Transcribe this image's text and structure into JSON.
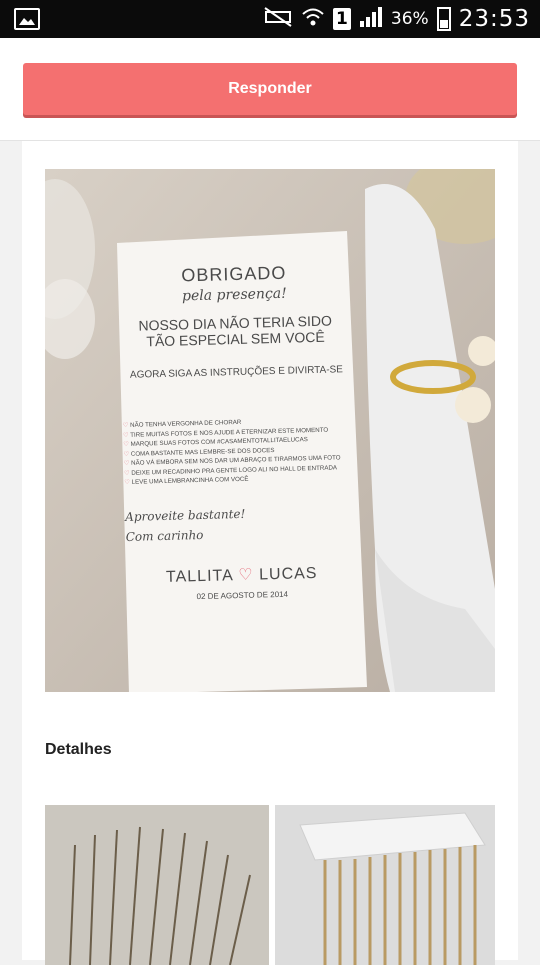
{
  "status_bar": {
    "sim_slot": "1",
    "battery_percent": "36%",
    "time": "23:53",
    "icons": [
      "image-notification-icon",
      "mute-icon",
      "wifi-icon",
      "signal-icon",
      "battery-icon"
    ]
  },
  "topbar": {
    "reply_label": "Responder"
  },
  "photo": {
    "card_title": "OBRIGADO",
    "card_subtitle": "pela presença!",
    "line1": "NOSSO DIA NÃO TERIA SIDO",
    "line2": "TÃO ESPECIAL SEM VOCÊ",
    "instructions": "AGORA SIGA AS INSTRUÇÕES E DIVIRTA-SE",
    "list": [
      "NÃO TENHA VERGONHA DE CHORAR",
      "TIRE MUITAS FOTOS E NOS AJUDE A ETERNIZAR ESTE MOMENTO",
      "MARQUE SUAS FOTOS COM #CASAMENTOTALLITAELUCAS",
      "COMA BASTANTE MAS LEMBRE-SE DOS DOCES",
      "NÃO VÁ EMBORA SEM NOS DAR UM ABRAÇO E TIRARMOS UMA FOTO",
      "DEIXE UM RECADINHO PRA GENTE LOGO ALI NO HALL DE ENTRADA",
      "LEVE UMA LEMBRANCINHA COM VOCÊ"
    ],
    "closing1": "Aproveite bastante!",
    "closing2": "Com carinho",
    "couple_a": "TALLITA",
    "couple_b": "LUCAS",
    "date": "02 DE AGOSTO DE 2014"
  },
  "details": {
    "title": "Detalhes"
  },
  "colors": {
    "accent": "#f47070",
    "heart": "#e46a78"
  }
}
